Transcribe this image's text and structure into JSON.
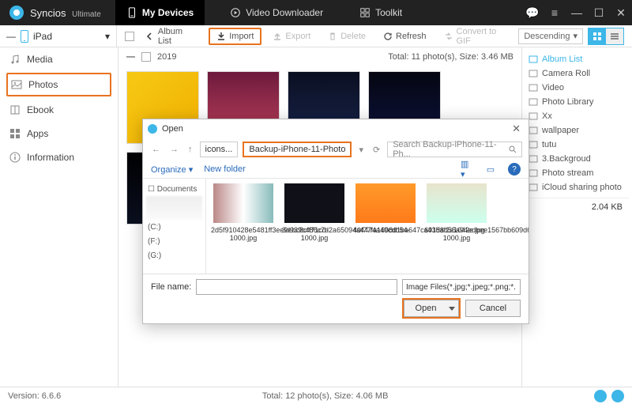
{
  "title": {
    "brand": "Syncios",
    "edition": "Ultimate"
  },
  "topTabs": {
    "devices": "My Devices",
    "video": "Video Downloader",
    "toolkit": "Toolkit"
  },
  "window": {
    "menu": "≡",
    "min": "—",
    "max": "☐",
    "close": "✕",
    "chat": "💬"
  },
  "device": {
    "name": "iPad",
    "chevron": "▾"
  },
  "toolbar": {
    "albumList": "Album List",
    "import": "Import",
    "export": "Export",
    "delete": "Delete",
    "refresh": "Refresh",
    "toGif": "Convert to GIF",
    "sort": "Descending",
    "sortArrow": "▾"
  },
  "sidebar": {
    "media": "Media",
    "photos": "Photos",
    "ebook": "Ebook",
    "apps": "Apps",
    "info": "Information"
  },
  "year": {
    "label": "2019",
    "summary": "Total: 11 photo(s), Size: 3.46 MB"
  },
  "albums": {
    "head": "Album List",
    "items": [
      "Camera Roll",
      "Video",
      "Photo Library",
      "Xx",
      "wallpaper",
      "tutu",
      "3.Backgroud",
      "Photo stream",
      "iCloud sharing photo"
    ],
    "size": "2.04 KB"
  },
  "status": {
    "version": "Version: 6.6.6",
    "total": "Total: 12 photo(s), Size: 4.06 MB"
  },
  "dialog": {
    "title": "Open",
    "close": "✕",
    "back": "←",
    "fwd": "→",
    "up": "↑",
    "crumbPrefix": "icons...",
    "crumb": "Backup-iPhone-11-Photo",
    "crumbDrop": "▾",
    "refresh": "⟳",
    "searchPlaceholder": "Search Backup-iPhone-11-Ph...",
    "organize": "Organize",
    "organizeDrop": "▾",
    "newFolder": "New folder",
    "side": {
      "docs": "☐ Documents",
      "c": "(C:)",
      "f": "(F:)",
      "g": "(G:)"
    },
    "files": [
      "2d5f910428e5481ff3ee9ebc8cff71cd-1000.jpg",
      "3d939c486c7d2a65094a4474a49cdb54-1000.jpg",
      "40f77fa1608d1ba647ca435af2a1042e.jpg",
      "691d8d55a94edbee1567bb609d6d6601-1000.jpg"
    ],
    "fileNameLabel": "File name:",
    "filter": "Image Files(*.jpg;*.jpeg;*.png;*.",
    "open": "Open",
    "cancel": "Cancel"
  }
}
